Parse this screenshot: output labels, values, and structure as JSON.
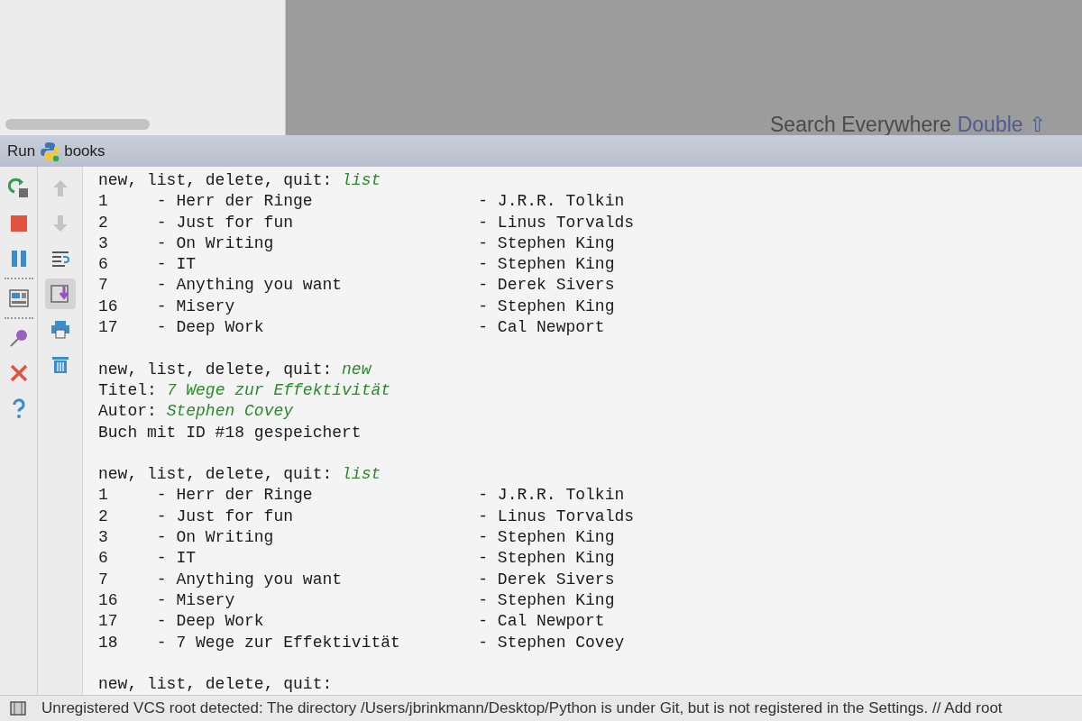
{
  "hint": {
    "label": "Search Everywhere",
    "shortcut": "Double ⇧"
  },
  "run_panel": {
    "label": "Run",
    "config": "books"
  },
  "console": [
    {
      "kind": "prompt",
      "text": "new, list, delete, quit: ",
      "input": "list"
    },
    {
      "kind": "row",
      "id": "1",
      "title": "- Herr der Ringe",
      "author": "- J.R.R. Tolkin"
    },
    {
      "kind": "row",
      "id": "2",
      "title": "- Just for fun",
      "author": "- Linus Torvalds"
    },
    {
      "kind": "row",
      "id": "3",
      "title": "- On Writing",
      "author": "- Stephen King"
    },
    {
      "kind": "row",
      "id": "6",
      "title": "- IT",
      "author": "- Stephen King"
    },
    {
      "kind": "row",
      "id": "7",
      "title": "- Anything you want",
      "author": "- Derek Sivers"
    },
    {
      "kind": "row",
      "id": "16",
      "title": "- Misery",
      "author": "- Stephen King"
    },
    {
      "kind": "row",
      "id": "17",
      "title": "- Deep Work",
      "author": "- Cal Newport"
    },
    {
      "kind": "blank"
    },
    {
      "kind": "prompt",
      "text": "new, list, delete, quit: ",
      "input": "new"
    },
    {
      "kind": "prompt",
      "text": "Titel: ",
      "input": "7 Wege zur Effektivität"
    },
    {
      "kind": "prompt",
      "text": "Autor: ",
      "input": "Stephen Covey"
    },
    {
      "kind": "plain",
      "text": "Buch mit ID #18 gespeichert"
    },
    {
      "kind": "blank"
    },
    {
      "kind": "prompt",
      "text": "new, list, delete, quit: ",
      "input": "list"
    },
    {
      "kind": "row",
      "id": "1",
      "title": "- Herr der Ringe",
      "author": "- J.R.R. Tolkin"
    },
    {
      "kind": "row",
      "id": "2",
      "title": "- Just for fun",
      "author": "- Linus Torvalds"
    },
    {
      "kind": "row",
      "id": "3",
      "title": "- On Writing",
      "author": "- Stephen King"
    },
    {
      "kind": "row",
      "id": "6",
      "title": "- IT",
      "author": "- Stephen King"
    },
    {
      "kind": "row",
      "id": "7",
      "title": "- Anything you want",
      "author": "- Derek Sivers"
    },
    {
      "kind": "row",
      "id": "16",
      "title": "- Misery",
      "author": "- Stephen King"
    },
    {
      "kind": "row",
      "id": "17",
      "title": "- Deep Work",
      "author": "- Cal Newport"
    },
    {
      "kind": "row",
      "id": "18",
      "title": "- 7 Wege zur Effektivität",
      "author": "- Stephen Covey"
    },
    {
      "kind": "blank"
    },
    {
      "kind": "plain",
      "text": "new, list, delete, quit:"
    }
  ],
  "status_bar": {
    "message": "Unregistered VCS root detected: The directory /Users/jbrinkmann/Desktop/Python is under Git, but is not registered in the Settings. // Add root"
  }
}
